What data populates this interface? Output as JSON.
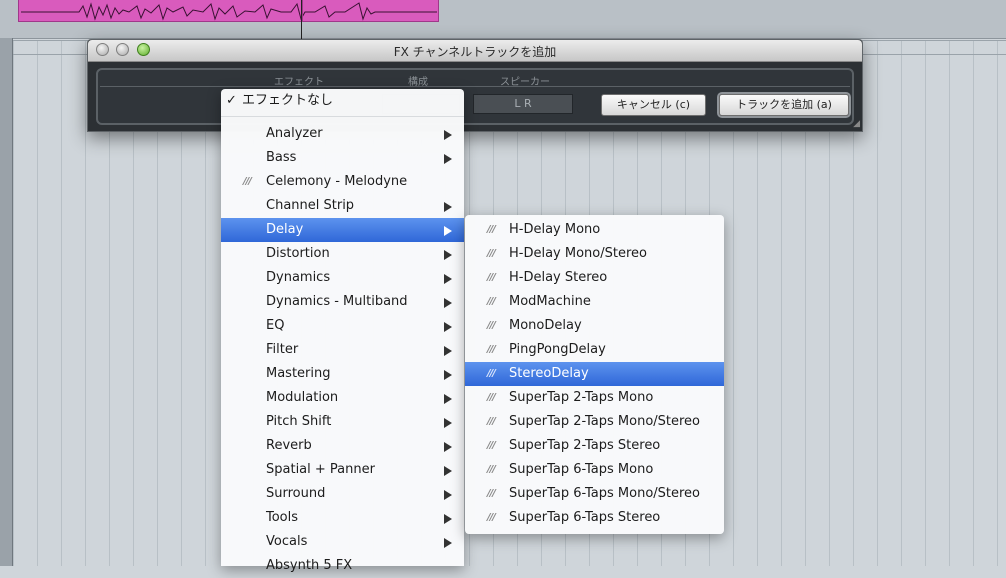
{
  "dialog": {
    "title": "FX チャンネルトラックを追加",
    "headers": {
      "effect": "エフェクト",
      "config": "構成",
      "speaker": "スピーカー"
    },
    "speaker_value": "L R",
    "cancel_label": "キャンセル (c)",
    "add_label": "トラックを追加 (a)"
  },
  "menu": {
    "none_label": "エフェクトなし",
    "categories": [
      "Analyzer",
      "Bass",
      "Celemony - Melodyne",
      "Channel Strip",
      "Delay",
      "Distortion",
      "Dynamics",
      "Dynamics - Multiband",
      "EQ",
      "Filter",
      "Mastering",
      "Modulation",
      "Pitch Shift",
      "Reverb",
      "Spatial + Panner",
      "Surround",
      "Tools",
      "Vocals",
      "Absynth 5 FX"
    ],
    "selected_category": "Delay"
  },
  "submenu": {
    "items": [
      "H-Delay Mono",
      "H-Delay Mono/Stereo",
      "H-Delay Stereo",
      "ModMachine",
      "MonoDelay",
      "PingPongDelay",
      "StereoDelay",
      "SuperTap 2-Taps Mono",
      "SuperTap 2-Taps Mono/Stereo",
      "SuperTap 2-Taps Stereo",
      "SuperTap 6-Taps Mono",
      "SuperTap 6-Taps Mono/Stereo",
      "SuperTap 6-Taps Stereo"
    ],
    "selected_item": "StereoDelay"
  },
  "colors": {
    "highlight": "#3470dd",
    "audio_event": "#d95bbd",
    "dialog_bg": "#2c3034"
  }
}
